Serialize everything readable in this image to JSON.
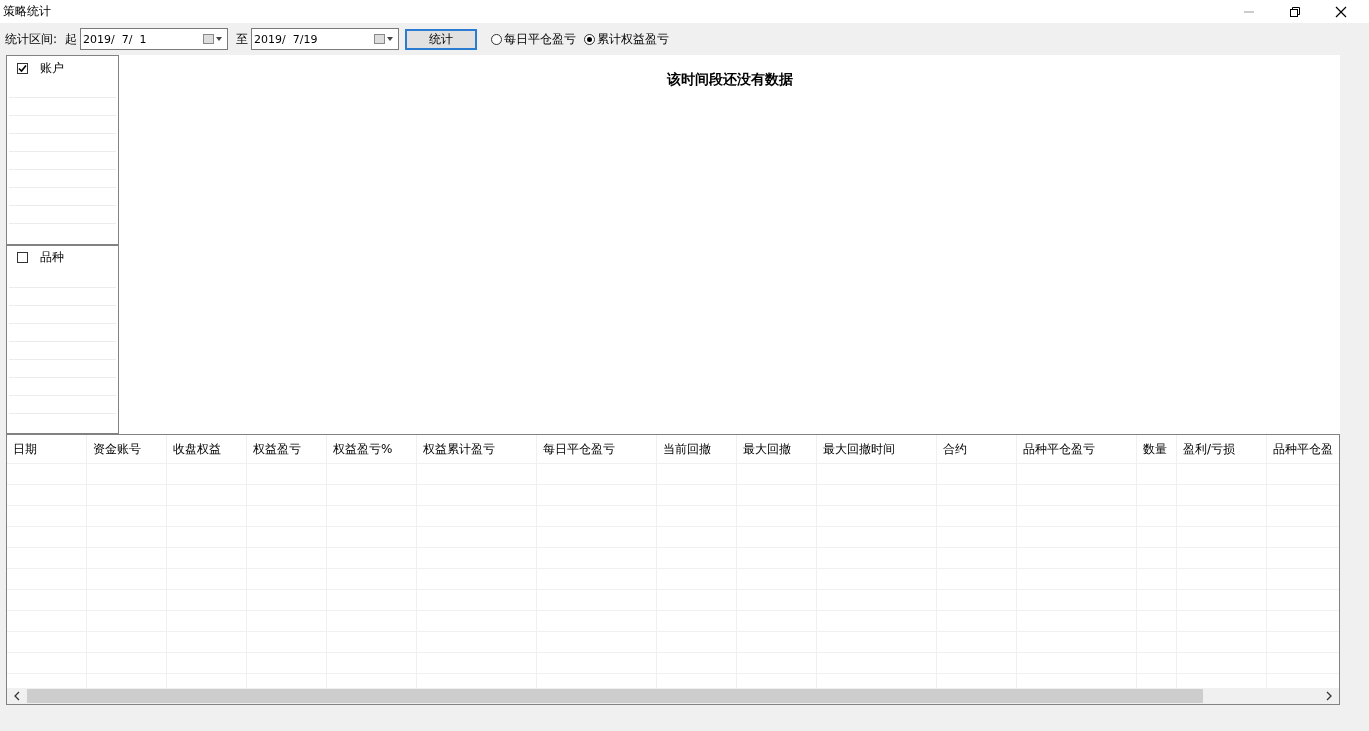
{
  "window": {
    "title": "策略统计"
  },
  "toolbar": {
    "range_label": "统计区间:",
    "from_label": "起",
    "from_date": "2019/  7/  1",
    "to_label": "至",
    "to_date": "2019/  7/19",
    "run_button": "统计",
    "modes": [
      {
        "label": "每日平仓盈亏",
        "selected": false
      },
      {
        "label": "累计权益盈亏",
        "selected": true
      }
    ]
  },
  "filters": [
    {
      "label": "账户",
      "checked": true
    },
    {
      "label": "品种",
      "checked": false
    }
  ],
  "chart": {
    "message": "该时间段还没有数据"
  },
  "table": {
    "columns": [
      "日期",
      "资金账号",
      "收盘权益",
      "权益盈亏",
      "权益盈亏%",
      "权益累计盈亏",
      "每日平仓盈亏",
      "当前回撤",
      "最大回撤",
      "最大回撤时间",
      "合约",
      "品种平仓盈亏",
      "数量",
      "盈利/亏损",
      "品种平仓盈"
    ]
  }
}
